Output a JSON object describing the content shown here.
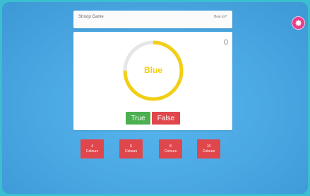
{
  "header": {
    "title": "Stroop Game",
    "how_to_label": "How to?"
  },
  "score": "0",
  "stimulus": {
    "word": "Blue",
    "color": "#f2cf14",
    "timer_remaining": 0.75
  },
  "answers": {
    "true_label": "True",
    "false_label": "False"
  },
  "colour_options": [
    {
      "count": "4",
      "label": "Colours"
    },
    {
      "count": "6",
      "label": "Colours"
    },
    {
      "count": "8",
      "label": "Colours"
    },
    {
      "count": "10",
      "label": "Colours"
    }
  ],
  "colors": {
    "accent_pink": "#e83e8c",
    "true_green": "#4caf50",
    "false_red": "#e0474c",
    "ring_track": "#e6e6e6"
  },
  "icons": {
    "settings": "gear-icon"
  }
}
